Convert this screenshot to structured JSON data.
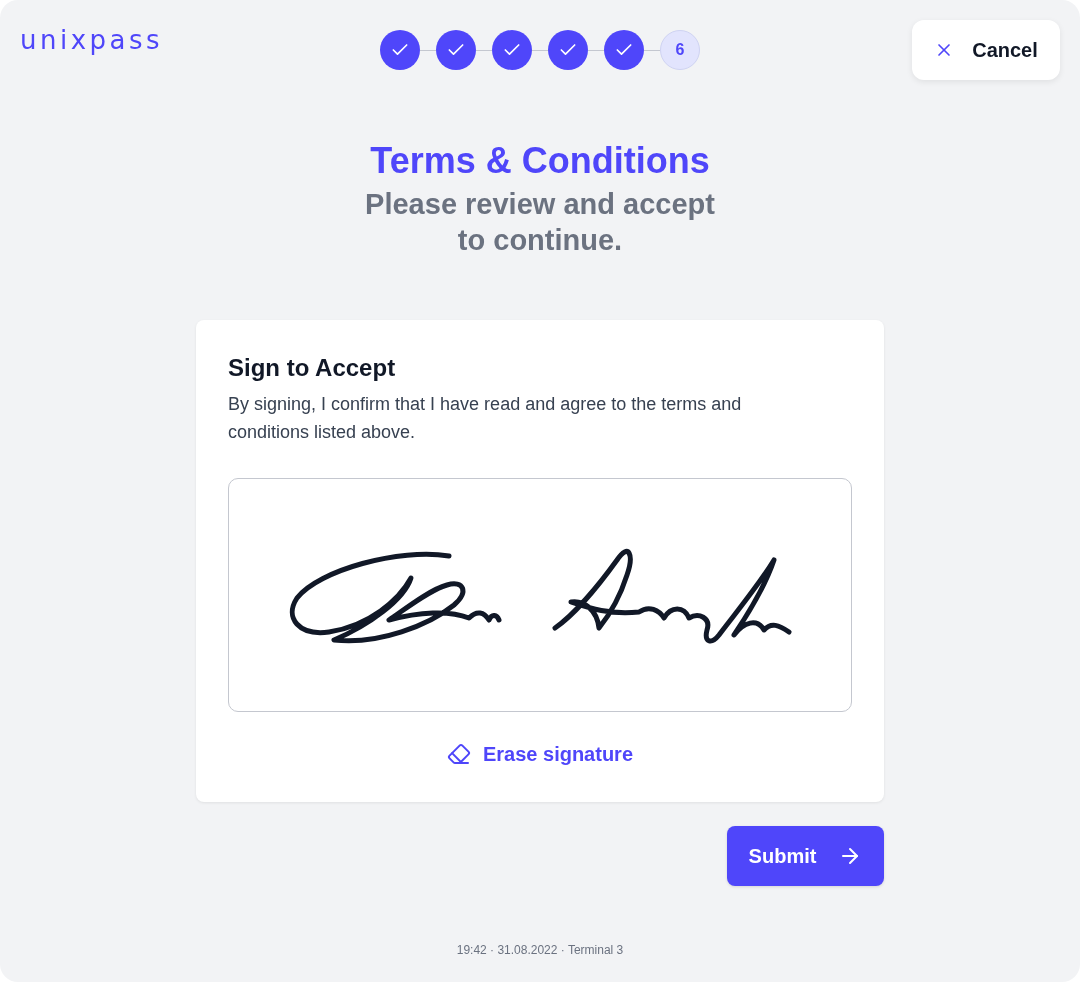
{
  "logo": "unixpass",
  "steps": [
    {
      "completed": true
    },
    {
      "completed": true
    },
    {
      "completed": true
    },
    {
      "completed": true
    },
    {
      "completed": true
    },
    {
      "completed": false,
      "label": "6"
    }
  ],
  "cancel_button": {
    "label": "Cancel"
  },
  "title": "Terms & Conditions",
  "subtitle": "Please review and accept to continue.",
  "card": {
    "heading": "Sign to Accept",
    "text": "By signing, I confirm that I have read and agree to the terms and conditions listed above.",
    "signature": {
      "signed": true
    },
    "erase_link": "Erase signature"
  },
  "submit_button": {
    "label": "Submit"
  },
  "footer": "19:42 · 31.08.2022 · Terminal 3"
}
